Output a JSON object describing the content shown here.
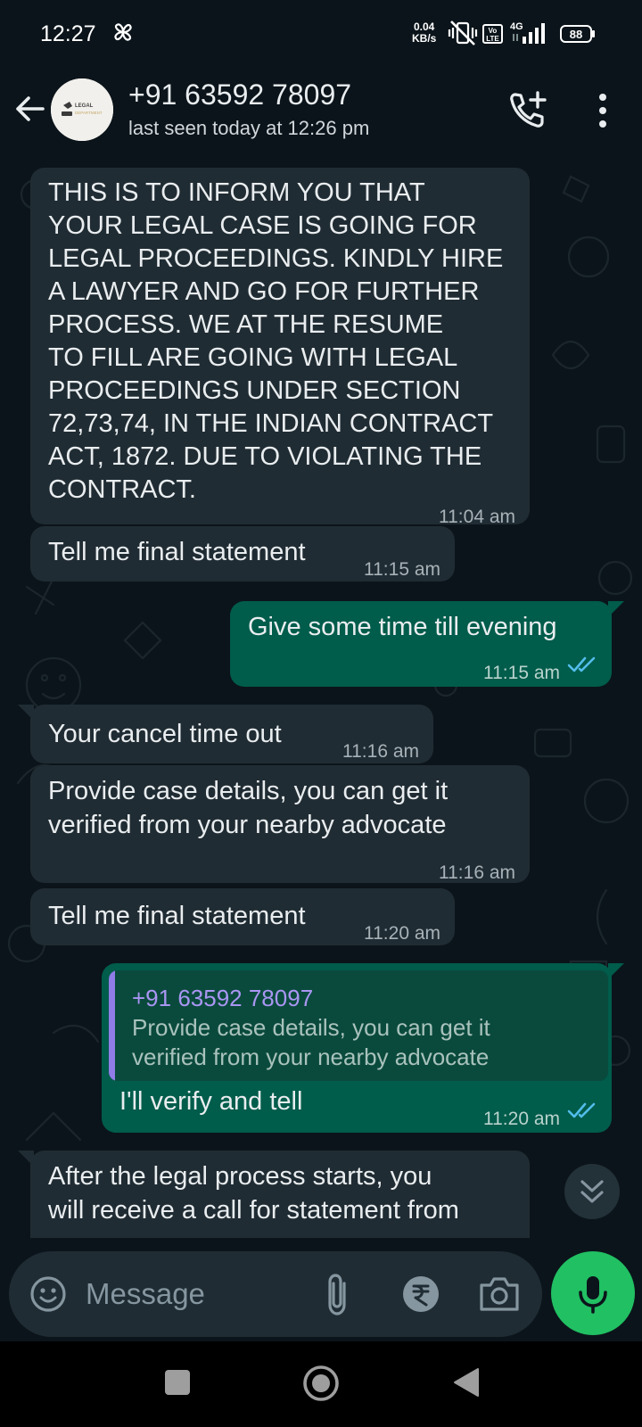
{
  "status_bar": {
    "time": "12:27",
    "net_speed_value": "0.04",
    "net_speed_unit": "KB/s",
    "volte_line1": "Vo",
    "volte_line2": "LTE",
    "network_type": "4G",
    "battery": "88"
  },
  "header": {
    "avatar_line1": "LEGAL",
    "avatar_line2": "DEPARTMENT",
    "contact_name": "+91 63592 78097",
    "last_seen": "last seen today at 12:26 pm"
  },
  "messages": [
    {
      "direction": "in",
      "text": [
        "THIS IS TO INFORM YOU THAT",
        "YOUR LEGAL CASE IS GOING FOR",
        "LEGAL PROCEEDINGS. KINDLY HIRE",
        "A LAWYER AND GO FOR FURTHER",
        "PROCESS. WE AT THE RESUME",
        "TO FILL ARE GOING WITH LEGAL",
        "PROCEEDINGS UNDER SECTION",
        "72,73,74, IN THE INDIAN CONTRACT",
        "ACT, 1872. DUE TO VIOLATING THE",
        "CONTRACT."
      ],
      "time": "11:04 am"
    },
    {
      "direction": "in",
      "text": [
        "Tell me final statement"
      ],
      "time": "11:15 am"
    },
    {
      "direction": "out",
      "text": [
        "Give some time till evening"
      ],
      "time": "11:15 am",
      "status": "read"
    },
    {
      "direction": "in",
      "text": [
        "Your cancel time out"
      ],
      "time": "11:16 am"
    },
    {
      "direction": "in",
      "text": [
        "Provide case details, you can get it",
        "verified from your nearby advocate"
      ],
      "time": "11:16 am"
    },
    {
      "direction": "in",
      "text": [
        "Tell me final statement"
      ],
      "time": "11:20 am"
    },
    {
      "direction": "out",
      "quote": {
        "name": "+91 63592 78097",
        "text": [
          "Provide case details, you can get it",
          "verified from your nearby advocate"
        ]
      },
      "text": [
        "I'll verify and tell"
      ],
      "time": "11:20 am",
      "status": "read"
    },
    {
      "direction": "in",
      "text": [
        "After the legal process starts, you",
        "will receive a call for statement from"
      ],
      "time": ""
    }
  ],
  "composer": {
    "placeholder": "Message"
  },
  "colors": {
    "background": "#0b141a",
    "incoming_bubble": "#202c33",
    "outgoing_bubble": "#005c4b",
    "accent_green": "#21c063",
    "read_ticks": "#53bdeb",
    "quote_accent": "#8f7ce6"
  },
  "icons": {
    "back": "arrow-left-icon",
    "add_call": "phone-plus-icon",
    "menu": "more-vertical-icon",
    "scroll": "double-chevron-down-icon",
    "emoji": "emoji-icon",
    "attach": "paperclip-icon",
    "payment": "rupee-icon",
    "camera": "camera-icon",
    "mic": "mic-icon"
  }
}
